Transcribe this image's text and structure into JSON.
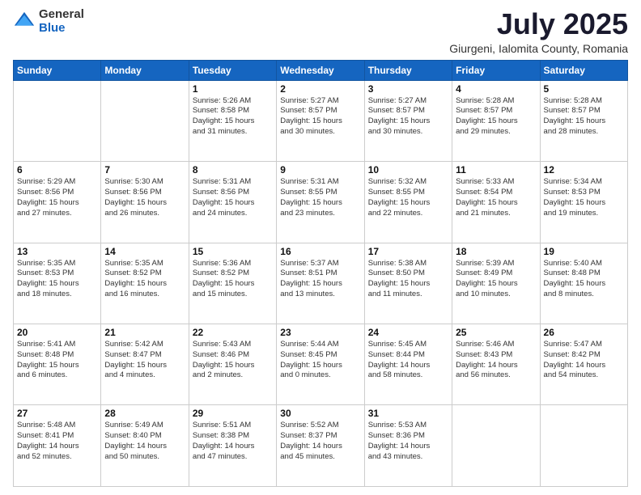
{
  "header": {
    "logo_general": "General",
    "logo_blue": "Blue",
    "month_title": "July 2025",
    "location": "Giurgeni, Ialomita County, Romania"
  },
  "days_of_week": [
    "Sunday",
    "Monday",
    "Tuesday",
    "Wednesday",
    "Thursday",
    "Friday",
    "Saturday"
  ],
  "weeks": [
    [
      {
        "day": "",
        "info": ""
      },
      {
        "day": "",
        "info": ""
      },
      {
        "day": "1",
        "info": "Sunrise: 5:26 AM\nSunset: 8:58 PM\nDaylight: 15 hours\nand 31 minutes."
      },
      {
        "day": "2",
        "info": "Sunrise: 5:27 AM\nSunset: 8:57 PM\nDaylight: 15 hours\nand 30 minutes."
      },
      {
        "day": "3",
        "info": "Sunrise: 5:27 AM\nSunset: 8:57 PM\nDaylight: 15 hours\nand 30 minutes."
      },
      {
        "day": "4",
        "info": "Sunrise: 5:28 AM\nSunset: 8:57 PM\nDaylight: 15 hours\nand 29 minutes."
      },
      {
        "day": "5",
        "info": "Sunrise: 5:28 AM\nSunset: 8:57 PM\nDaylight: 15 hours\nand 28 minutes."
      }
    ],
    [
      {
        "day": "6",
        "info": "Sunrise: 5:29 AM\nSunset: 8:56 PM\nDaylight: 15 hours\nand 27 minutes."
      },
      {
        "day": "7",
        "info": "Sunrise: 5:30 AM\nSunset: 8:56 PM\nDaylight: 15 hours\nand 26 minutes."
      },
      {
        "day": "8",
        "info": "Sunrise: 5:31 AM\nSunset: 8:56 PM\nDaylight: 15 hours\nand 24 minutes."
      },
      {
        "day": "9",
        "info": "Sunrise: 5:31 AM\nSunset: 8:55 PM\nDaylight: 15 hours\nand 23 minutes."
      },
      {
        "day": "10",
        "info": "Sunrise: 5:32 AM\nSunset: 8:55 PM\nDaylight: 15 hours\nand 22 minutes."
      },
      {
        "day": "11",
        "info": "Sunrise: 5:33 AM\nSunset: 8:54 PM\nDaylight: 15 hours\nand 21 minutes."
      },
      {
        "day": "12",
        "info": "Sunrise: 5:34 AM\nSunset: 8:53 PM\nDaylight: 15 hours\nand 19 minutes."
      }
    ],
    [
      {
        "day": "13",
        "info": "Sunrise: 5:35 AM\nSunset: 8:53 PM\nDaylight: 15 hours\nand 18 minutes."
      },
      {
        "day": "14",
        "info": "Sunrise: 5:35 AM\nSunset: 8:52 PM\nDaylight: 15 hours\nand 16 minutes."
      },
      {
        "day": "15",
        "info": "Sunrise: 5:36 AM\nSunset: 8:52 PM\nDaylight: 15 hours\nand 15 minutes."
      },
      {
        "day": "16",
        "info": "Sunrise: 5:37 AM\nSunset: 8:51 PM\nDaylight: 15 hours\nand 13 minutes."
      },
      {
        "day": "17",
        "info": "Sunrise: 5:38 AM\nSunset: 8:50 PM\nDaylight: 15 hours\nand 11 minutes."
      },
      {
        "day": "18",
        "info": "Sunrise: 5:39 AM\nSunset: 8:49 PM\nDaylight: 15 hours\nand 10 minutes."
      },
      {
        "day": "19",
        "info": "Sunrise: 5:40 AM\nSunset: 8:48 PM\nDaylight: 15 hours\nand 8 minutes."
      }
    ],
    [
      {
        "day": "20",
        "info": "Sunrise: 5:41 AM\nSunset: 8:48 PM\nDaylight: 15 hours\nand 6 minutes."
      },
      {
        "day": "21",
        "info": "Sunrise: 5:42 AM\nSunset: 8:47 PM\nDaylight: 15 hours\nand 4 minutes."
      },
      {
        "day": "22",
        "info": "Sunrise: 5:43 AM\nSunset: 8:46 PM\nDaylight: 15 hours\nand 2 minutes."
      },
      {
        "day": "23",
        "info": "Sunrise: 5:44 AM\nSunset: 8:45 PM\nDaylight: 15 hours\nand 0 minutes."
      },
      {
        "day": "24",
        "info": "Sunrise: 5:45 AM\nSunset: 8:44 PM\nDaylight: 14 hours\nand 58 minutes."
      },
      {
        "day": "25",
        "info": "Sunrise: 5:46 AM\nSunset: 8:43 PM\nDaylight: 14 hours\nand 56 minutes."
      },
      {
        "day": "26",
        "info": "Sunrise: 5:47 AM\nSunset: 8:42 PM\nDaylight: 14 hours\nand 54 minutes."
      }
    ],
    [
      {
        "day": "27",
        "info": "Sunrise: 5:48 AM\nSunset: 8:41 PM\nDaylight: 14 hours\nand 52 minutes."
      },
      {
        "day": "28",
        "info": "Sunrise: 5:49 AM\nSunset: 8:40 PM\nDaylight: 14 hours\nand 50 minutes."
      },
      {
        "day": "29",
        "info": "Sunrise: 5:51 AM\nSunset: 8:38 PM\nDaylight: 14 hours\nand 47 minutes."
      },
      {
        "day": "30",
        "info": "Sunrise: 5:52 AM\nSunset: 8:37 PM\nDaylight: 14 hours\nand 45 minutes."
      },
      {
        "day": "31",
        "info": "Sunrise: 5:53 AM\nSunset: 8:36 PM\nDaylight: 14 hours\nand 43 minutes."
      },
      {
        "day": "",
        "info": ""
      },
      {
        "day": "",
        "info": ""
      }
    ]
  ]
}
